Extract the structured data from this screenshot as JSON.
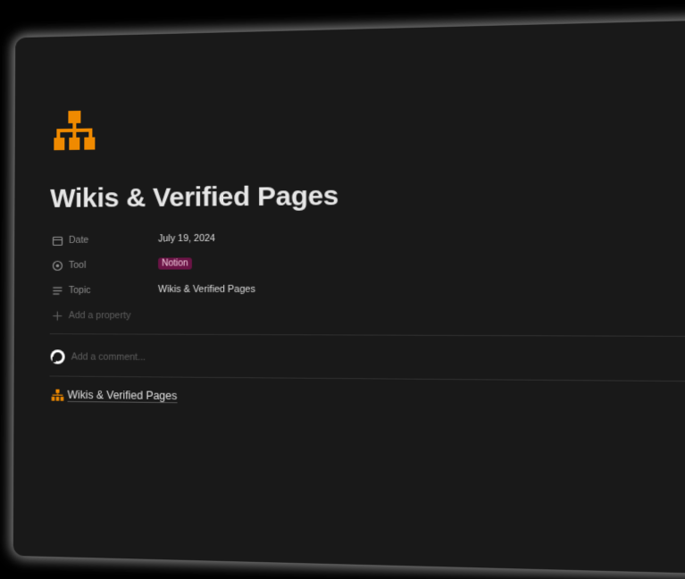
{
  "page": {
    "title": "Wikis & Verified Pages",
    "icon": "sitemap-icon",
    "accent": "#f08a00"
  },
  "properties": [
    {
      "label": "Date",
      "icon": "calendar-icon",
      "value": "July 19, 2024"
    },
    {
      "label": "Tool",
      "icon": "target-icon",
      "value": "Notion",
      "tag_color": "#6b1446"
    },
    {
      "label": "Topic",
      "icon": "text-lines-icon",
      "value": "Wikis & Verified Pages"
    }
  ],
  "add_property_label": "Add a property",
  "comment": {
    "placeholder": "Add a comment..."
  },
  "subpage": {
    "label": "Wikis & Verified Pages",
    "icon": "sitemap-icon"
  }
}
